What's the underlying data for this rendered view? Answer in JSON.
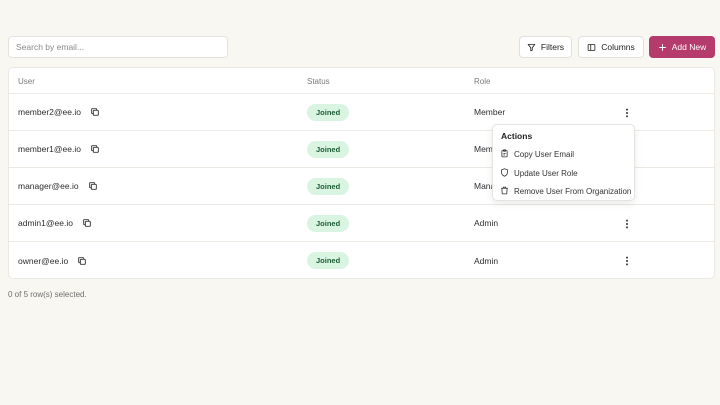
{
  "search": {
    "placeholder": "Search by email..."
  },
  "toolbar": {
    "filters_label": "Filters",
    "columns_label": "Columns",
    "add_new_label": "Add New",
    "add_new_icon": "plus-icon",
    "filters_icon": "filter-icon",
    "columns_icon": "columns-icon"
  },
  "colors": {
    "primary": "#b43b6c",
    "badge_bg": "#d9f5e2",
    "badge_text": "#1c5c32",
    "background": "#f8f7f2"
  },
  "table": {
    "headers": {
      "user": "User",
      "status": "Status",
      "role": "Role"
    },
    "rows": [
      {
        "email": "member2@ee.io",
        "status": "Joined",
        "role": "Member"
      },
      {
        "email": "member1@ee.io",
        "status": "Joined",
        "role": "Member"
      },
      {
        "email": "manager@ee.io",
        "status": "Joined",
        "role": "Manager"
      },
      {
        "email": "admin1@ee.io",
        "status": "Joined",
        "role": "Admin"
      },
      {
        "email": "owner@ee.io",
        "status": "Joined",
        "role": "Admin"
      }
    ]
  },
  "footer": {
    "selection": "0 of 5 row(s) selected."
  },
  "menu": {
    "title": "Actions",
    "items": [
      {
        "label": "Copy User Email",
        "icon": "clipboard-icon"
      },
      {
        "label": "Update User Role",
        "icon": "shield-icon"
      },
      {
        "label": "Remove User From Organization",
        "icon": "trash-icon"
      }
    ]
  }
}
